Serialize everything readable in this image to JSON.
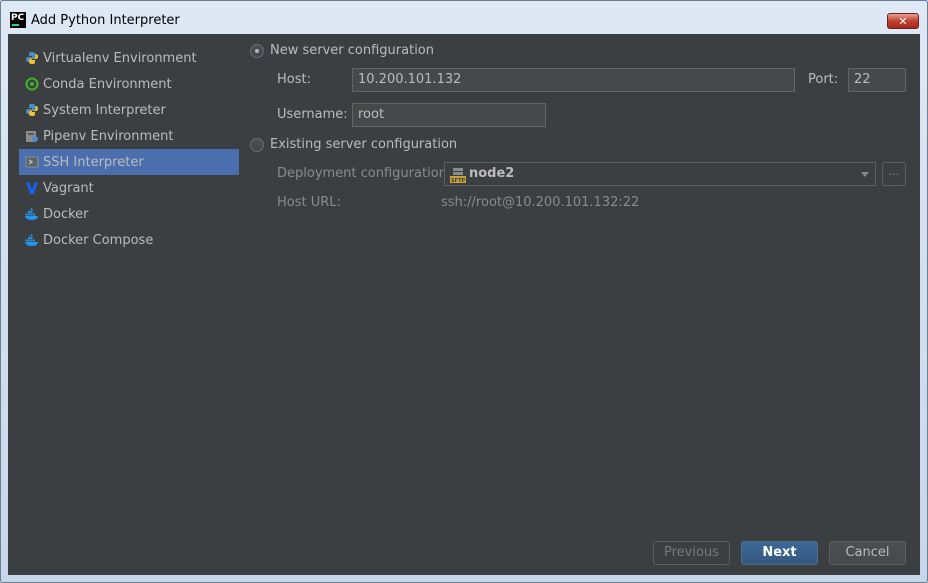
{
  "window": {
    "title": "Add Python Interpreter",
    "app_icon_text": "PC",
    "close_glyph": "✕"
  },
  "sidebar": {
    "items": [
      {
        "label": "Virtualenv Environment",
        "icon": "python-icon"
      },
      {
        "label": "Conda Environment",
        "icon": "conda-icon"
      },
      {
        "label": "System Interpreter",
        "icon": "python-icon"
      },
      {
        "label": "Pipenv Environment",
        "icon": "pipenv-icon"
      },
      {
        "label": "SSH Interpreter",
        "icon": "ssh-terminal-icon",
        "selected": true
      },
      {
        "label": "Vagrant",
        "icon": "vagrant-icon"
      },
      {
        "label": "Docker",
        "icon": "docker-icon"
      },
      {
        "label": "Docker Compose",
        "icon": "docker-icon"
      }
    ]
  },
  "new_server": {
    "radio_label": "New server configuration",
    "selected": true,
    "host_label": "Host:",
    "host_value": "10.200.101.132",
    "port_label": "Port:",
    "port_value": "22",
    "username_label": "Username:",
    "username_value": "root"
  },
  "existing_server": {
    "radio_label": "Existing server configuration",
    "selected": false,
    "deployment_label": "Deployment configuration:",
    "deployment_value": "node2",
    "browse_label": "...",
    "host_url_label": "Host URL:",
    "host_url_value": "ssh://root@10.200.101.132:22"
  },
  "footer": {
    "previous_label": "Previous",
    "next_label": "Next",
    "cancel_label": "Cancel"
  },
  "colors": {
    "background": "#3c3f41",
    "selection": "#4b6eaf",
    "text": "#bbbbbb",
    "primary_button": "#365880"
  }
}
